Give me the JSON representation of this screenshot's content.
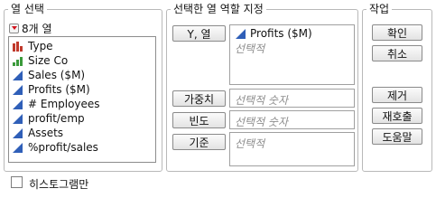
{
  "select_columns": {
    "title": "열 선택",
    "count_label": "8개 열",
    "columns": [
      {
        "name": "Type",
        "icon": "nominal-bar-icon"
      },
      {
        "name": "Size Co",
        "icon": "ordinal-bar-icon"
      },
      {
        "name": "Sales ($M)",
        "icon": "continuous-ramp-icon"
      },
      {
        "name": "Profits ($M)",
        "icon": "continuous-ramp-icon"
      },
      {
        "name": "# Employees",
        "icon": "continuous-ramp-icon"
      },
      {
        "name": "profit/emp",
        "icon": "continuous-ramp-icon"
      },
      {
        "name": "Assets",
        "icon": "continuous-ramp-icon"
      },
      {
        "name": "%profit/sales",
        "icon": "continuous-ramp-icon"
      }
    ]
  },
  "cast_roles": {
    "title": "선택한 열 역할 지정",
    "y_button": "Y, 열",
    "y_value": "Profits ($M)",
    "y_placeholder": "선택적",
    "weight_button": "가중치",
    "weight_placeholder": "선택적 숫자",
    "freq_button": "빈도",
    "freq_placeholder": "선택적 숫자",
    "by_button": "기준",
    "by_placeholder": "선택적"
  },
  "action": {
    "title": "작업",
    "ok": "확인",
    "cancel": "취소",
    "remove": "제거",
    "recall": "재호출",
    "help": "도움말"
  },
  "histogram_checkbox": {
    "label": "히스토그램만",
    "checked": false
  },
  "colors": {
    "nominal": "#c0392b",
    "ordinal": "#3b9a3b",
    "continuous": "#2f5fb8",
    "dropdown_arrow": "#d2131c"
  }
}
